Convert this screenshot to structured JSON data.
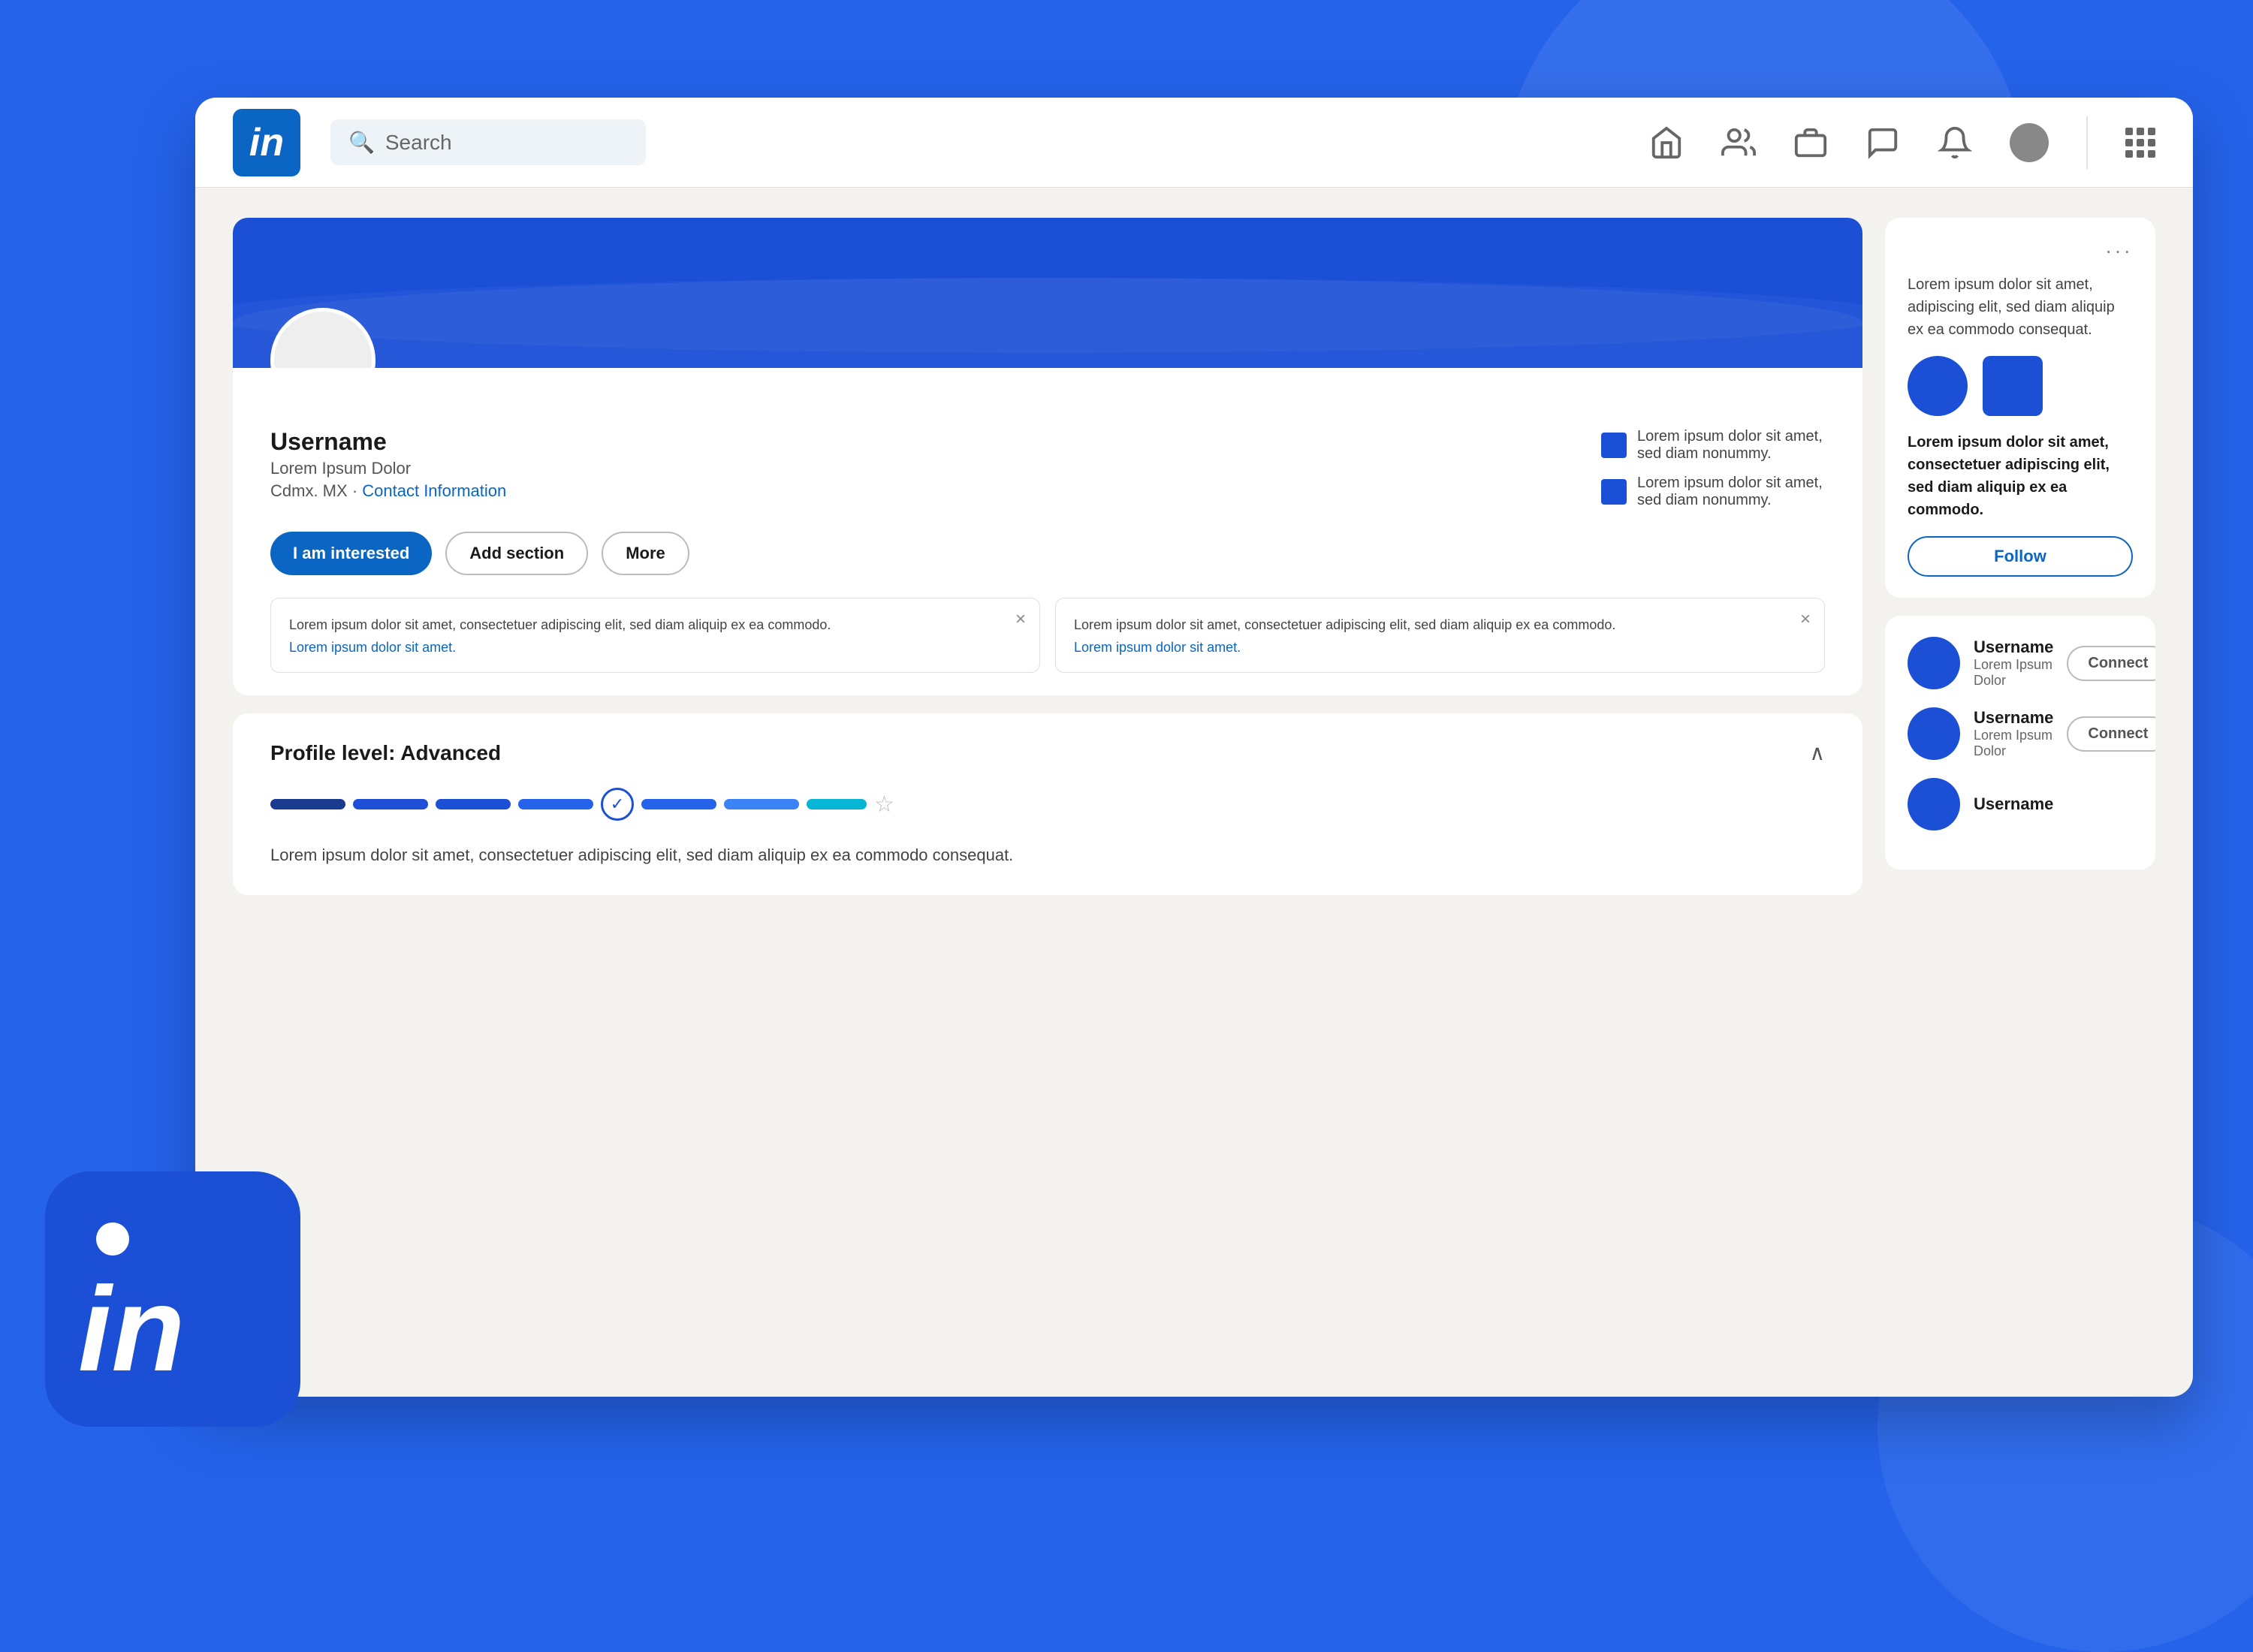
{
  "page": {
    "background_color": "#2563eb"
  },
  "navbar": {
    "logo_text": "in",
    "search_placeholder": "Search",
    "nav_items": [
      "home",
      "people",
      "briefcase",
      "chat",
      "bell",
      "avatar",
      "grid"
    ]
  },
  "profile": {
    "username": "Username",
    "subtitle": "Lorem Ipsum Dolor",
    "location": "Cdmx. MX",
    "contact_info_label": "Contact Information",
    "badge1_text": "Lorem ipsum dolor sit amet, sed diam nonummy.",
    "badge2_text": "Lorem ipsum dolor sit amet, sed diam nonummy.",
    "btn_interested": "I am interested",
    "btn_add_section": "Add section",
    "btn_more": "More"
  },
  "notifications": {
    "card1": {
      "text": "Lorem ipsum dolor sit amet, consectetuer adipiscing elit, sed diam aliquip ex ea commodo.",
      "link": "Lorem ipsum dolor sit amet."
    },
    "card2": {
      "text": "Lorem ipsum dolor sit amet, consectetuer adipiscing elit, sed diam aliquip ex ea commodo.",
      "link": "Lorem ipsum dolor sit amet."
    }
  },
  "profile_level": {
    "title": "Profile level: Advanced",
    "description": "Lorem ipsum dolor sit amet, consectetuer adipiscing elit, sed diam aliquip ex ea commodo consequat."
  },
  "sidebar": {
    "ad_text": "Lorem ipsum dolor sit amet, adipiscing elit, sed diam aliquip ex ea commodo consequat.",
    "ad_desc": "Lorem ipsum dolor sit amet, consectetuer adipiscing elit, sed diam aliquip ex ea commodo.",
    "follow_label": "Follow",
    "three_dots": "···"
  },
  "people": {
    "person1": {
      "name": "Username",
      "title": "Lorem Ipsum Dolor",
      "connect": "Connect"
    },
    "person2": {
      "name": "Username",
      "title": "Lorem Ipsum Dolor",
      "connect": "Connect"
    },
    "person3": {
      "name": "Username",
      "title": "",
      "connect": ""
    }
  }
}
